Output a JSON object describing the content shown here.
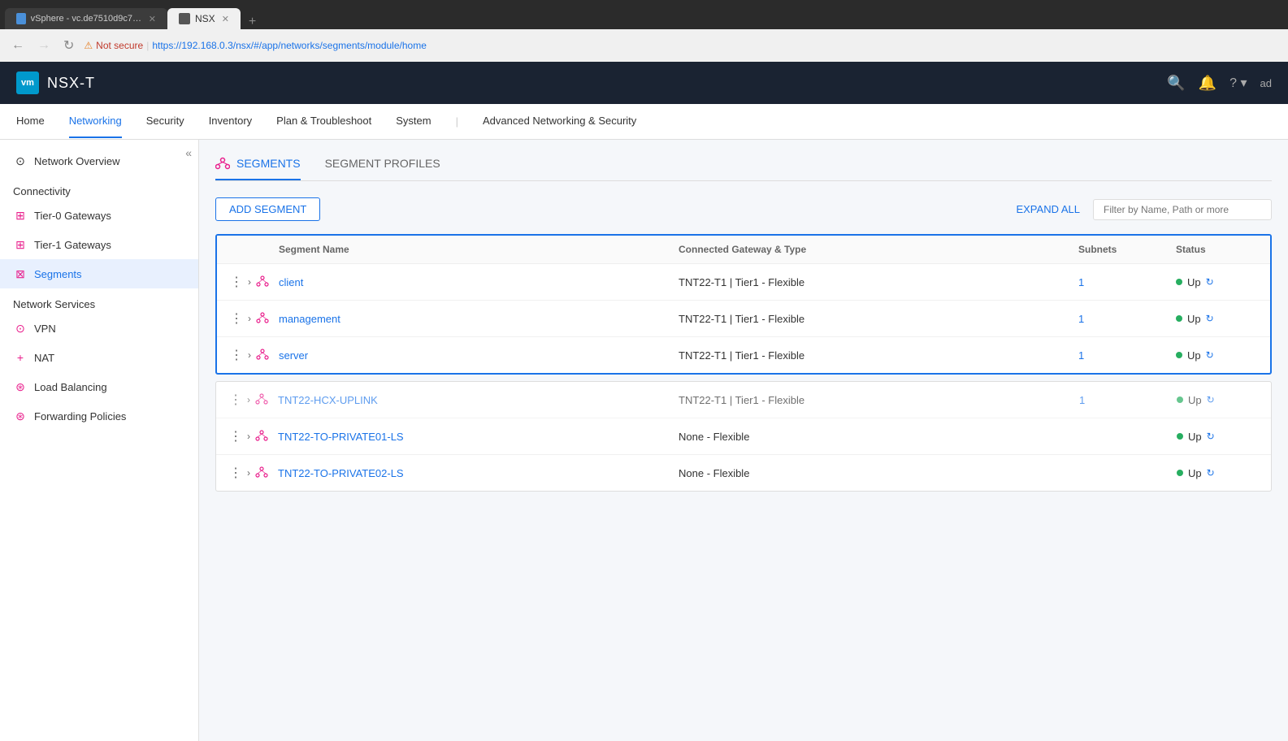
{
  "browser": {
    "tabs": [
      {
        "id": "vsphere",
        "label": "vSphere - vc.de7510d9c7d8485...",
        "active": false
      },
      {
        "id": "nsx",
        "label": "NSX",
        "active": true
      }
    ],
    "url": "https://192.168.0.3/nsx/#/app/networks/segments/module/home",
    "security_warning": "Not secure"
  },
  "header": {
    "logo_text": "vm",
    "app_name": "NSX-T",
    "actions": [
      "search",
      "bell",
      "help",
      "user"
    ]
  },
  "main_nav": {
    "items": [
      {
        "id": "home",
        "label": "Home",
        "active": false
      },
      {
        "id": "networking",
        "label": "Networking",
        "active": true
      },
      {
        "id": "security",
        "label": "Security",
        "active": false
      },
      {
        "id": "inventory",
        "label": "Inventory",
        "active": false
      },
      {
        "id": "plan_troubleshoot",
        "label": "Plan & Troubleshoot",
        "active": false
      },
      {
        "id": "system",
        "label": "System",
        "active": false
      },
      {
        "id": "advanced",
        "label": "Advanced Networking & Security",
        "active": false
      }
    ]
  },
  "sidebar": {
    "collapse_title": "Collapse sidebar",
    "items": [
      {
        "id": "network-overview",
        "label": "Network Overview",
        "icon": "⊙",
        "section": null
      },
      {
        "id": "connectivity-header",
        "label": "Connectivity",
        "type": "section"
      },
      {
        "id": "tier0-gateways",
        "label": "Tier-0 Gateways",
        "icon": "⊞",
        "active": false
      },
      {
        "id": "tier1-gateways",
        "label": "Tier-1 Gateways",
        "icon": "⊞",
        "active": false
      },
      {
        "id": "segments",
        "label": "Segments",
        "icon": "⊠",
        "active": true
      },
      {
        "id": "network-services-header",
        "label": "Network Services",
        "type": "section"
      },
      {
        "id": "vpn",
        "label": "VPN",
        "icon": "⊙",
        "active": false
      },
      {
        "id": "nat",
        "label": "NAT",
        "icon": "+",
        "active": false
      },
      {
        "id": "load-balancing",
        "label": "Load Balancing",
        "icon": "⊛",
        "active": false
      },
      {
        "id": "forwarding-policies",
        "label": "Forwarding Policies",
        "icon": "⊛",
        "active": false
      }
    ]
  },
  "content": {
    "tabs": [
      {
        "id": "segments",
        "label": "SEGMENTS",
        "active": true
      },
      {
        "id": "segment-profiles",
        "label": "SEGMENT PROFILES",
        "active": false
      }
    ],
    "add_segment_label": "ADD SEGMENT",
    "expand_all_label": "EXPAND ALL",
    "filter_placeholder": "Filter by Name, Path or more",
    "table": {
      "headers": [
        "",
        "Segment Name",
        "Connected Gateway & Type",
        "Subnets",
        "Status"
      ],
      "rows": [
        {
          "name": "client",
          "gateway": "TNT22-T1 | Tier1 - Flexible",
          "subnets": "1",
          "status": "Up",
          "highlighted": true
        },
        {
          "name": "management",
          "gateway": "TNT22-T1 | Tier1 - Flexible",
          "subnets": "1",
          "status": "Up",
          "highlighted": true
        },
        {
          "name": "server",
          "gateway": "TNT22-T1 | Tier1 - Flexible",
          "subnets": "1",
          "status": "Up",
          "highlighted": true
        },
        {
          "name": "TNT22-HCX-UPLINK",
          "gateway": "TNT22-T1 | Tier1 - Flexible",
          "subnets": "1",
          "status": "Up",
          "highlighted": false,
          "dimmed": true
        },
        {
          "name": "TNT22-TO-PRIVATE01-LS",
          "gateway": "None - Flexible",
          "subnets": "",
          "status": "Up",
          "highlighted": false
        },
        {
          "name": "TNT22-TO-PRIVATE02-LS",
          "gateway": "None - Flexible",
          "subnets": "",
          "status": "Up",
          "highlighted": false
        }
      ]
    }
  }
}
